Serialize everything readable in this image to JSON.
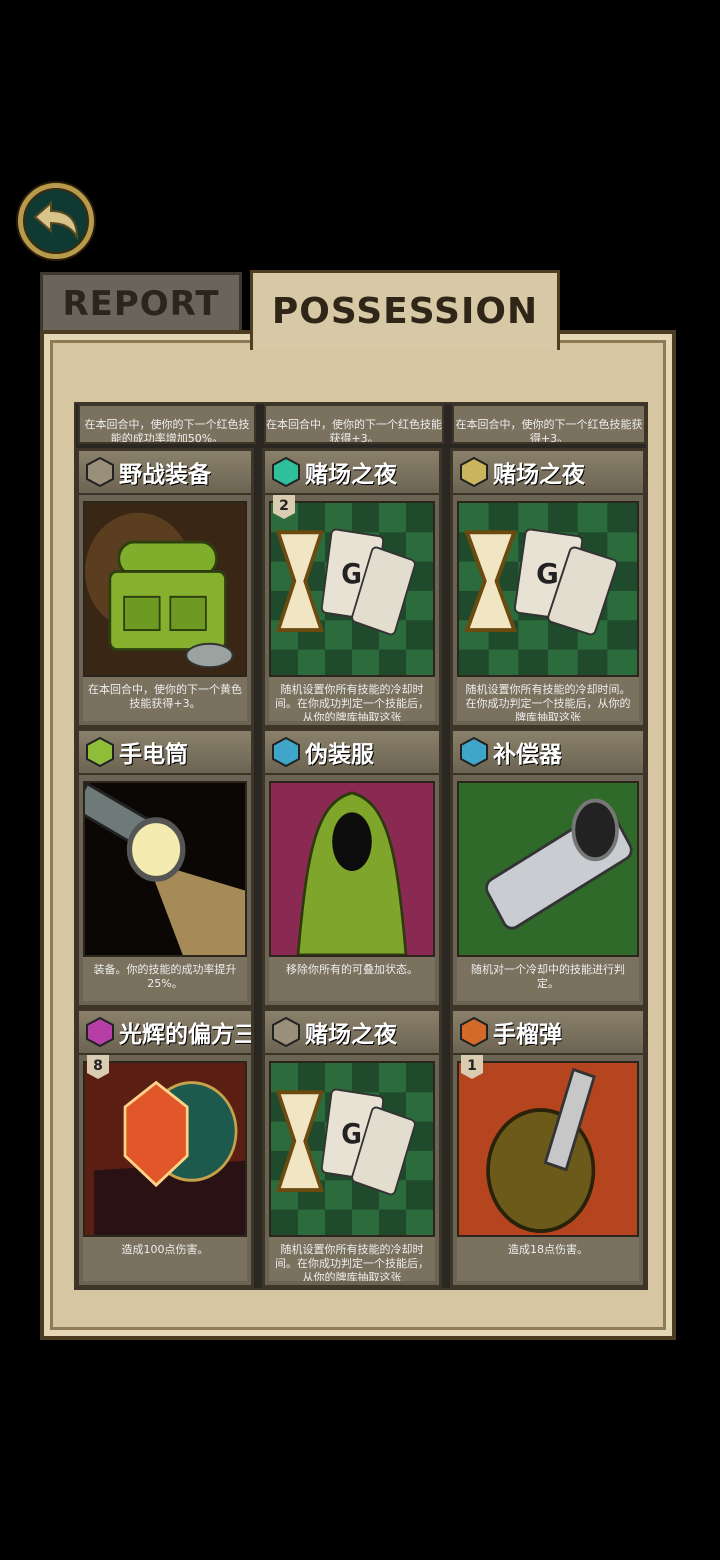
{
  "tabs": {
    "report": "REPORT",
    "possession": "POSSESSION"
  },
  "top_descs": [
    "在本回合中，使你的下一个红色技能的成功率增加50%。",
    "在本回合中，使你的下一个红色技能获得+3。",
    "在本回合中，使你的下一个红色技能获得+3。"
  ],
  "cards": [
    {
      "name": "野战装备",
      "badge": "",
      "gem": "#9a8f78",
      "desc": "在本回合中，使你的下一个黄色技能获得+3。",
      "art": "backpack"
    },
    {
      "name": "赌场之夜",
      "badge": "2",
      "gem": "#2fbf9a",
      "desc": "随机设置你所有技能的冷却时间。在你成功判定一个技能后，从你的牌库抽取这张",
      "art": "cards"
    },
    {
      "name": "赌场之夜",
      "badge": "",
      "gem": "#c9b55b",
      "desc": "随机设置你所有技能的冷却时间。在你成功判定一个技能后，从你的牌库抽取这张",
      "art": "cards"
    },
    {
      "name": "手电筒",
      "badge": "",
      "gem": "#8fbf3a",
      "desc": "装备。你的技能的成功率提升25%。",
      "art": "flashlight"
    },
    {
      "name": "伪装服",
      "badge": "",
      "gem": "#3fa6c9",
      "desc": "移除你所有的可叠加状态。",
      "art": "ghillie"
    },
    {
      "name": "补偿器",
      "badge": "",
      "gem": "#3fa6c9",
      "desc": "随机对一个冷却中的技能进行判定。",
      "art": "compensator"
    },
    {
      "name": "光辉的偏方三八面",
      "badge": "8",
      "gem": "#b53fa6",
      "desc": "造成100点伤害。",
      "art": "crystal"
    },
    {
      "name": "赌场之夜",
      "badge": "",
      "gem": "#9a8f78",
      "desc": "随机设置你所有技能的冷却时间。在你成功判定一个技能后，从你的牌库抽取这张",
      "art": "cards"
    },
    {
      "name": "手榴弹",
      "badge": "1",
      "gem": "#d46a2a",
      "desc": "造成18点伤害。",
      "art": "grenade"
    }
  ]
}
